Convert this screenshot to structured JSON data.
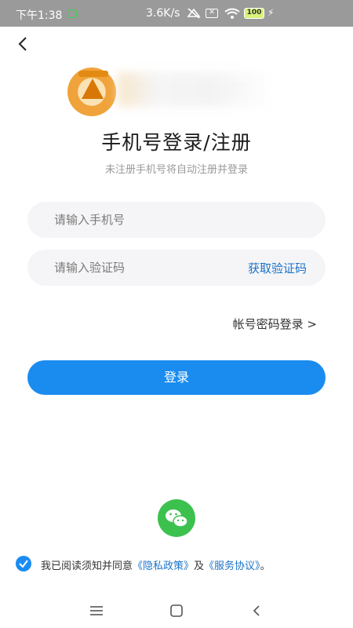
{
  "status_bar": {
    "time": "下午1:38",
    "network_speed": "3.6K/s",
    "battery": "100",
    "icons": [
      "app-notification-icon",
      "mute-icon",
      "sim-icon",
      "wifi-icon",
      "battery-icon",
      "charging-icon"
    ]
  },
  "nav": {
    "back_icon": "back-arrow-icon"
  },
  "header": {
    "title": "手机号登录/注册",
    "subtitle": "未注册手机号将自动注册并登录"
  },
  "form": {
    "phone_placeholder": "请输入手机号",
    "code_placeholder": "请输入验证码",
    "get_code_label": "获取验证码",
    "password_login_label": "帐号密码登录 >",
    "login_button_label": "登录"
  },
  "social": {
    "wechat_icon": "wechat-icon"
  },
  "agreement": {
    "checked": true,
    "prefix": "我已阅读须知并同意",
    "privacy_link": "《隐私政策》",
    "conjunction": "及",
    "service_link": "《服务协议》",
    "suffix": "。"
  },
  "system_nav": {
    "icons": [
      "menu-icon",
      "home-icon",
      "back-icon"
    ]
  },
  "colors": {
    "primary": "#1a8cf0",
    "link": "#1b73c9",
    "wechat": "#3cc14f",
    "input_bg": "#f5f5f7"
  }
}
